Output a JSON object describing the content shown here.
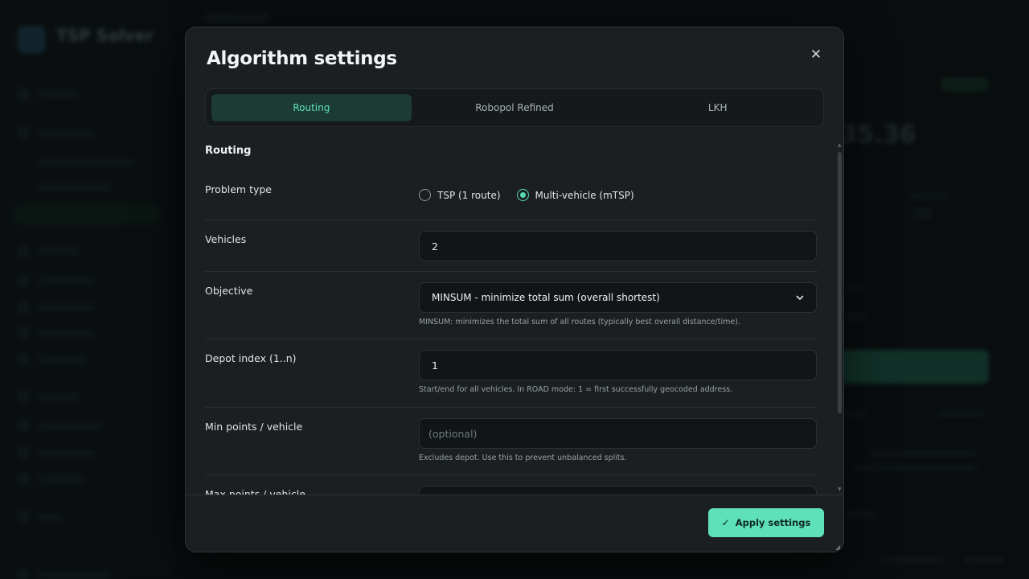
{
  "background": {
    "brand": "TSP Solver",
    "big_value": "35.36"
  },
  "modal": {
    "title": "Algorithm settings",
    "close_icon": "close-icon",
    "tabs": [
      {
        "label": "Routing",
        "active": true
      },
      {
        "label": "Robopol Refined",
        "active": false
      },
      {
        "label": "LKH",
        "active": false
      }
    ],
    "section_title": "Routing",
    "problem_type": {
      "label": "Problem type",
      "options": [
        {
          "label": "TSP (1 route)",
          "selected": false
        },
        {
          "label": "Multi-vehicle (mTSP)",
          "selected": true
        }
      ]
    },
    "vehicles": {
      "label": "Vehicles",
      "value": "2"
    },
    "objective": {
      "label": "Objective",
      "selected": "MINSUM - minimize total sum (overall shortest)",
      "hint": "MINSUM: minimizes the total sum of all routes (typically best overall distance/time)."
    },
    "depot_index": {
      "label": "Depot index (1..n)",
      "value": "1",
      "hint": "Start/end for all vehicles. In ROAD mode: 1 = first successfully geocoded address."
    },
    "min_points": {
      "label": "Min points / vehicle",
      "placeholder": "(optional)",
      "hint": "Excludes depot. Use this to prevent unbalanced splits."
    },
    "max_points": {
      "label": "Max points / vehicle"
    },
    "apply_label": "Apply settings"
  },
  "colors": {
    "accent": "#5ee0b8",
    "modal_bg": "#1b1f21",
    "active_tab_bg": "#1c3b35"
  }
}
